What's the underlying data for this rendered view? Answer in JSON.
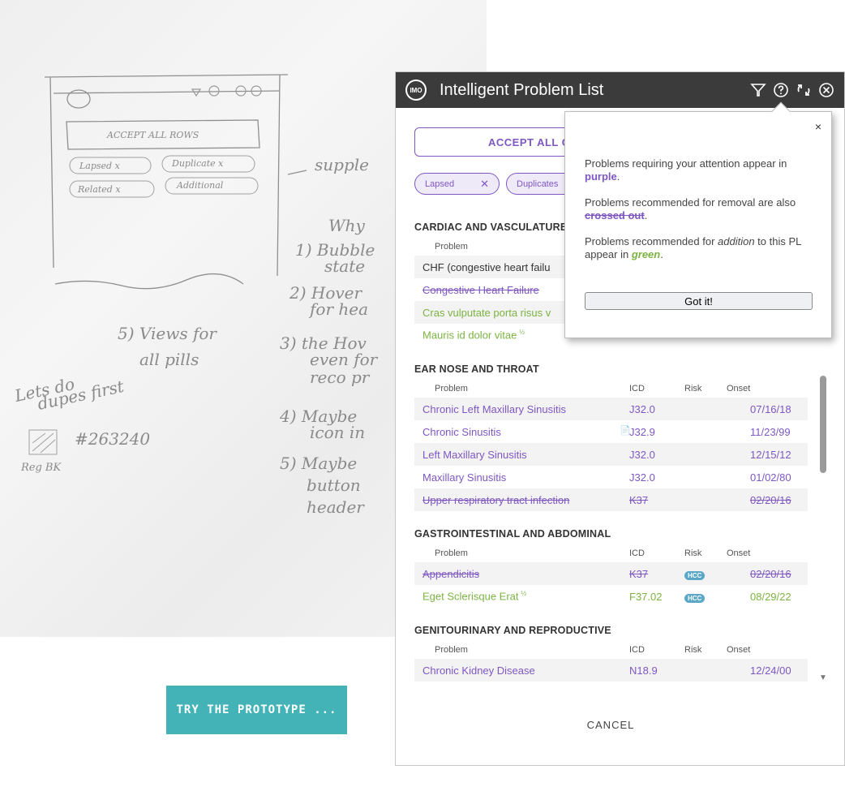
{
  "prototype_button": "TRY THE PROTOTYPE ...",
  "sketch": {
    "accept": "ACCEPT ALL ROWS",
    "pills": [
      "Lapsed x",
      "Duplicate x",
      "Related x",
      "Additional"
    ],
    "notes": [
      "supple",
      "Why",
      "1) Bubble",
      "state",
      "2) Hover",
      "for hea",
      "3) the Hov",
      "even for",
      "reco pr",
      "4) Maybe",
      "icon in",
      "5) Maybe",
      "button",
      "header",
      "5) Views for",
      "all pills",
      "Lets do",
      "dupes first",
      "#263240",
      "Reg BK"
    ]
  },
  "window": {
    "logo": "IMO",
    "title": "Intelligent Problem List",
    "accept_all": "ACCEPT ALL C",
    "pills": [
      {
        "label": "Lapsed",
        "close": "✕"
      },
      {
        "label": "Duplicates"
      }
    ],
    "columns": {
      "problem": "Problem",
      "icd": "ICD",
      "risk": "Risk",
      "onset": "Onset"
    },
    "sections": [
      {
        "title": "CARDIAC AND VASCULATURE",
        "rows": [
          {
            "problem": "CHF (congestive heart failu"
          },
          {
            "problem": "Congestive Heart Failure"
          },
          {
            "problem": "Cras vulputate porta risus v"
          },
          {
            "problem": "Mauris id dolor vitae",
            "sup": "½"
          }
        ]
      },
      {
        "title": "EAR NOSE AND THROAT",
        "rows": [
          {
            "problem": "Chronic Left Maxillary Sinusitis",
            "icd": "J32.0",
            "onset": "07/16/18"
          },
          {
            "problem": "Chronic Sinusitis",
            "icd": "J32.9",
            "onset": "11/23/99"
          },
          {
            "problem": "Left Maxillary Sinusitis",
            "icd": "J32.0",
            "onset": "12/15/12"
          },
          {
            "problem": "Maxillary Sinusitis",
            "icd": "J32.0",
            "onset": "01/02/80"
          },
          {
            "problem": "Upper respiratory tract infection",
            "icd": "K37",
            "onset": "02/20/16"
          }
        ]
      },
      {
        "title": "GASTROINTESTINAL AND ABDOMINAL",
        "rows": [
          {
            "problem": "Appendicitis",
            "icd": "K37",
            "risk": "HCC",
            "onset": "02/20/16"
          },
          {
            "problem": "Eget Sclerisque Erat",
            "sup": "½",
            "icd": "F37.02",
            "risk": "HCC",
            "onset": "08/29/22"
          }
        ]
      },
      {
        "title": "GENITOURINARY AND REPRODUCTIVE",
        "rows": [
          {
            "problem": "Chronic Kidney Disease",
            "icd": "N18.9",
            "onset": "12/24/00"
          }
        ]
      }
    ],
    "cancel": "CANCEL"
  },
  "popover": {
    "close": "×",
    "p1_a": "Problems requiring your attention appear in ",
    "p1_b": "purple",
    "p1_c": ".",
    "p2_a": "Problems recommended for removal are also ",
    "p2_b": "crossed out",
    "p2_c": ".",
    "p3_a": "Problems recommended for ",
    "p3_b": "addition",
    "p3_c": " to this PL appear in ",
    "p3_d": "green",
    "p3_e": ".",
    "button": "Got it!"
  },
  "colors": {
    "purple": "#7e57c2",
    "green": "#7cb342",
    "teal": "#44b3b8",
    "titlebar": "#3b3b3b",
    "hcc": "#5aa7c7"
  }
}
